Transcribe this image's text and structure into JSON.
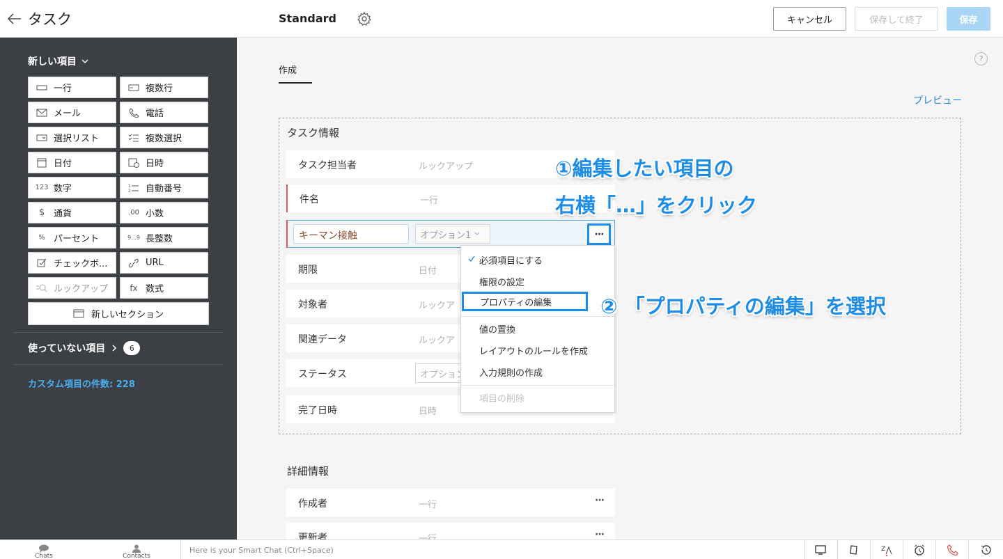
{
  "header": {
    "title": "タスク",
    "layout_name": "Standard",
    "cancel_label": "キャンセル",
    "save_close_label": "保存して終了",
    "save_label": "保存"
  },
  "sidebar": {
    "new_items_label": "新しい項目",
    "field_types": [
      {
        "label": "一行",
        "icon": "single-line-icon"
      },
      {
        "label": "複数行",
        "icon": "multi-line-icon"
      },
      {
        "label": "メール",
        "icon": "mail-icon"
      },
      {
        "label": "電話",
        "icon": "phone-icon"
      },
      {
        "label": "選択リスト",
        "icon": "picklist-icon"
      },
      {
        "label": "複数選択",
        "icon": "multiselect-icon"
      },
      {
        "label": "日付",
        "icon": "calendar-icon"
      },
      {
        "label": "日時",
        "icon": "datetime-icon"
      },
      {
        "label": "数字",
        "icon": "number-icon",
        "glyph": "123"
      },
      {
        "label": "自動番号",
        "icon": "autonumber-icon"
      },
      {
        "label": "通貨",
        "icon": "currency-icon",
        "glyph": "$"
      },
      {
        "label": "小数",
        "icon": "decimal-icon",
        "glyph": ".00"
      },
      {
        "label": "パーセント",
        "icon": "percent-icon",
        "glyph": "%"
      },
      {
        "label": "長整数",
        "icon": "long-integer-icon",
        "glyph": "9...9"
      },
      {
        "label": "チェックボ...",
        "icon": "checkbox-icon"
      },
      {
        "label": "URL",
        "icon": "link-icon"
      },
      {
        "label": "ルックアップ",
        "icon": "lookup-icon",
        "disabled": true
      },
      {
        "label": "数式",
        "icon": "formula-icon",
        "glyph": "fx"
      }
    ],
    "new_section_label": "新しいセクション",
    "unused_label": "使っていない項目",
    "unused_count": "6",
    "custom_count_label": "カスタム項目の件数: 228"
  },
  "main": {
    "tab_label": "作成",
    "help_glyph": "?",
    "preview_label": "プレビュー",
    "section1": {
      "title": "タスク情報",
      "rows": [
        {
          "label": "タスク担当者",
          "type": "ルックアップ"
        },
        {
          "label": "件名",
          "type": "一行"
        },
        {
          "label": "キーマン接触",
          "type": "オプション1"
        },
        {
          "label": "期限",
          "type": "日付"
        },
        {
          "label": "対象者",
          "type": "ルックア"
        },
        {
          "label": "関連データ",
          "type": "ルックア"
        },
        {
          "label": "ステータス",
          "type": "オプション"
        },
        {
          "label": "完了日時",
          "type": "日時"
        }
      ]
    },
    "section2": {
      "title": "詳細情報",
      "rows": [
        {
          "label": "作成者",
          "type": "一行"
        },
        {
          "label": "更新者",
          "type": "一行"
        }
      ]
    },
    "more_glyph": "···"
  },
  "menu": {
    "items": [
      "必須項目にする",
      "権限の設定",
      "プロパティの編集",
      "値の置換",
      "レイアウトのルールを作成",
      "入力規則の作成",
      "項目の削除"
    ]
  },
  "annotations": {
    "step1_line1": "①編集したい項目の",
    "step1_line2": "右横「…」をクリック",
    "step2": "② 「プロパティの編集」を選択"
  },
  "bottombar": {
    "chats_label": "Chats",
    "contacts_label": "Contacts",
    "chat_placeholder": "Here is your Smart Chat (Ctrl+Space)"
  },
  "colors": {
    "accent": "#1e8de8",
    "sidebar_bg": "#3c3f43",
    "required_marker": "#e05a5a",
    "link": "#2e8bd6"
  }
}
